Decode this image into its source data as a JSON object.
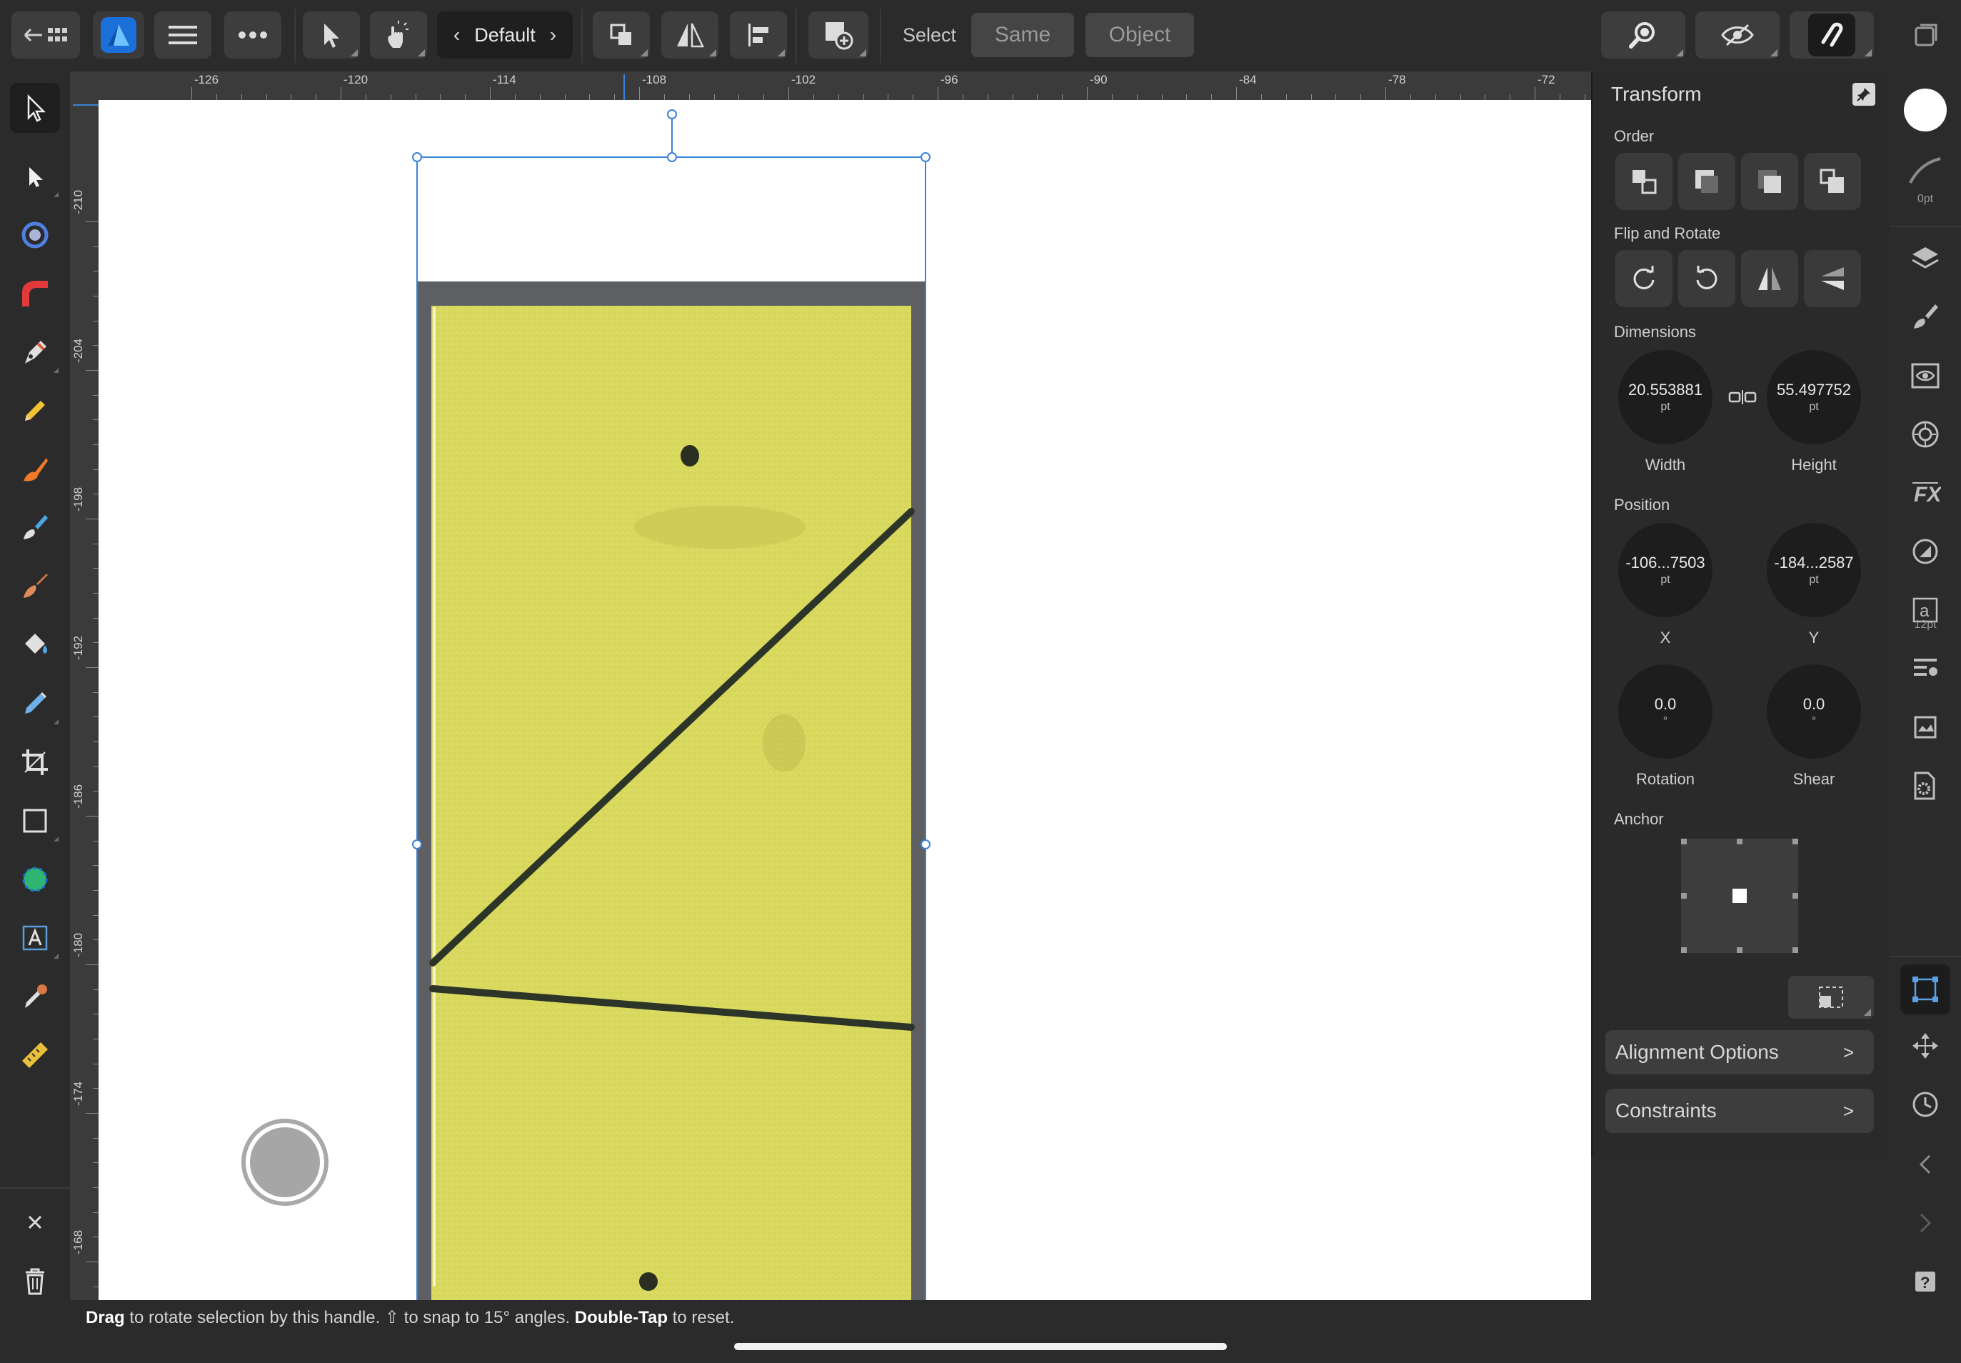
{
  "toolbar": {
    "persona_label": "Default",
    "select_label": "Select",
    "same_label": "Same",
    "object_label": "Object"
  },
  "ruler": {
    "unit": "pt",
    "h_labels": [
      "-126",
      "-120",
      "-114",
      "-108",
      "-102",
      "-96",
      "-90",
      "-84",
      "-78",
      "-72"
    ],
    "v_labels": [
      "-210",
      "-204",
      "-198",
      "-192",
      "-186",
      "-180",
      "-174",
      "-168"
    ]
  },
  "panel": {
    "title": "Transform",
    "order_label": "Order",
    "flip_rotate_label": "Flip and Rotate",
    "dimensions_label": "Dimensions",
    "width_value": "20.553881",
    "width_unit": "pt",
    "width_label": "Width",
    "height_value": "55.497752",
    "height_unit": "pt",
    "height_label": "Height",
    "position_label": "Position",
    "x_value": "-106...7503",
    "x_unit": "pt",
    "x_label": "X",
    "y_value": "-184...2587",
    "y_unit": "pt",
    "y_label": "Y",
    "rotation_value": "0.0",
    "rotation_unit": "°",
    "rotation_label": "Rotation",
    "shear_value": "0.0",
    "shear_unit": "°",
    "shear_label": "Shear",
    "anchor_label": "Anchor",
    "alignment_options_label": "Alignment Options",
    "constraints_label": "Constraints"
  },
  "right_strip": {
    "stroke_width": "0pt",
    "text_size": "12pt"
  },
  "status": {
    "hint_drag": "Drag",
    "hint_text1": " to rotate selection by this handle. ",
    "hint_shift": "⇧",
    "hint_text2": " to snap to 15° angles. ",
    "hint_doubletap": "Double-Tap",
    "hint_text3": " to reset."
  },
  "colors": {
    "accent": "#2a8cff",
    "selection": "#3b82d6",
    "paper_yellow": "#d7d75a",
    "photo_border": "#5d5f63"
  },
  "icons": {
    "back": "back-grid-icon",
    "app_logo": "affinity-designer-logo",
    "menu": "hamburger-icon",
    "more": "more-dots-icon"
  }
}
